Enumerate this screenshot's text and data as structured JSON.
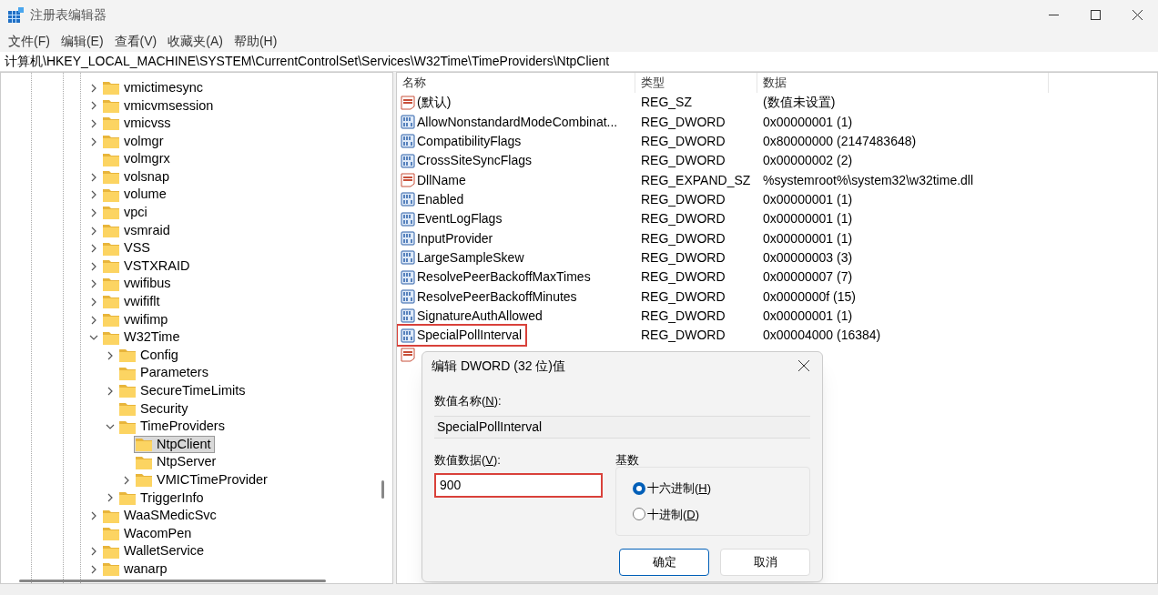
{
  "window": {
    "title": "注册表编辑器"
  },
  "menu": [
    "文件(F)",
    "编辑(E)",
    "查看(V)",
    "收藏夹(A)",
    "帮助(H)"
  ],
  "address": "计算机\\HKEY_LOCAL_MACHINE\\SYSTEM\\CurrentControlSet\\Services\\W32Time\\TimeProviders\\NtpClient",
  "tree": [
    {
      "label": "vmictimesync",
      "expandable": true,
      "expanded": false,
      "selected": false
    },
    {
      "label": "vmicvmsession",
      "expandable": true,
      "expanded": false,
      "selected": false
    },
    {
      "label": "vmicvss",
      "expandable": true,
      "expanded": false,
      "selected": false
    },
    {
      "label": "volmgr",
      "expandable": true,
      "expanded": false,
      "selected": false
    },
    {
      "label": "volmgrx",
      "expandable": false,
      "selected": false
    },
    {
      "label": "volsnap",
      "expandable": true,
      "expanded": false,
      "selected": false
    },
    {
      "label": "volume",
      "expandable": true,
      "expanded": false,
      "selected": false
    },
    {
      "label": "vpci",
      "expandable": true,
      "expanded": false,
      "selected": false
    },
    {
      "label": "vsmraid",
      "expandable": true,
      "expanded": false,
      "selected": false
    },
    {
      "label": "VSS",
      "expandable": true,
      "expanded": false,
      "selected": false
    },
    {
      "label": "VSTXRAID",
      "expandable": true,
      "expanded": false,
      "selected": false
    },
    {
      "label": "vwifibus",
      "expandable": true,
      "expanded": false,
      "selected": false
    },
    {
      "label": "vwififlt",
      "expandable": true,
      "expanded": false,
      "selected": false
    },
    {
      "label": "vwifimp",
      "expandable": true,
      "expanded": false,
      "selected": false
    },
    {
      "label": "W32Time",
      "expandable": true,
      "expanded": true,
      "selected": false,
      "children": [
        {
          "label": "Config",
          "expandable": true,
          "expanded": false,
          "selected": false
        },
        {
          "label": "Parameters",
          "expandable": false,
          "selected": false
        },
        {
          "label": "SecureTimeLimits",
          "expandable": true,
          "expanded": false,
          "selected": false
        },
        {
          "label": "Security",
          "expandable": false,
          "selected": false
        },
        {
          "label": "TimeProviders",
          "expandable": true,
          "expanded": true,
          "selected": false,
          "children": [
            {
              "label": "NtpClient",
              "expandable": false,
              "selected": true
            },
            {
              "label": "NtpServer",
              "expandable": false,
              "selected": false
            },
            {
              "label": "VMICTimeProvider",
              "expandable": true,
              "expanded": false,
              "selected": false
            }
          ]
        },
        {
          "label": "TriggerInfo",
          "expandable": true,
          "expanded": false,
          "selected": false
        }
      ]
    },
    {
      "label": "WaaSMedicSvc",
      "expandable": true,
      "expanded": false,
      "selected": false
    },
    {
      "label": "WacomPen",
      "expandable": false,
      "selected": false
    },
    {
      "label": "WalletService",
      "expandable": true,
      "expanded": false,
      "selected": false
    },
    {
      "label": "wanarp",
      "expandable": true,
      "expanded": false,
      "selected": false
    }
  ],
  "table": {
    "columns": [
      "名称",
      "类型",
      "数据"
    ],
    "rows": [
      {
        "kind": "string",
        "name": "(默认)",
        "type": "REG_SZ",
        "data": "(数值未设置)",
        "annotated": false
      },
      {
        "kind": "binary",
        "name": "AllowNonstandardModeCombinat...",
        "type": "REG_DWORD",
        "data": "0x00000001 (1)",
        "annotated": false
      },
      {
        "kind": "binary",
        "name": "CompatibilityFlags",
        "type": "REG_DWORD",
        "data": "0x80000000 (2147483648)",
        "annotated": false
      },
      {
        "kind": "binary",
        "name": "CrossSiteSyncFlags",
        "type": "REG_DWORD",
        "data": "0x00000002 (2)",
        "annotated": false
      },
      {
        "kind": "string",
        "name": "DllName",
        "type": "REG_EXPAND_SZ",
        "data": "%systemroot%\\system32\\w32time.dll",
        "annotated": false
      },
      {
        "kind": "binary",
        "name": "Enabled",
        "type": "REG_DWORD",
        "data": "0x00000001 (1)",
        "annotated": false
      },
      {
        "kind": "binary",
        "name": "EventLogFlags",
        "type": "REG_DWORD",
        "data": "0x00000001 (1)",
        "annotated": false
      },
      {
        "kind": "binary",
        "name": "InputProvider",
        "type": "REG_DWORD",
        "data": "0x00000001 (1)",
        "annotated": false
      },
      {
        "kind": "binary",
        "name": "LargeSampleSkew",
        "type": "REG_DWORD",
        "data": "0x00000003 (3)",
        "annotated": false
      },
      {
        "kind": "binary",
        "name": "ResolvePeerBackoffMaxTimes",
        "type": "REG_DWORD",
        "data": "0x00000007 (7)",
        "annotated": false
      },
      {
        "kind": "binary",
        "name": "ResolvePeerBackoffMinutes",
        "type": "REG_DWORD",
        "data": "0x0000000f (15)",
        "annotated": false
      },
      {
        "kind": "binary",
        "name": "SignatureAuthAllowed",
        "type": "REG_DWORD",
        "data": "0x00000001 (1)",
        "annotated": false
      },
      {
        "kind": "binary",
        "name": "SpecialPollInterval",
        "type": "REG_DWORD",
        "data": "0x00004000 (16384)",
        "annotated": true
      },
      {
        "kind": "string"
      }
    ]
  },
  "dialog": {
    "title": "编辑 DWORD (32 位)值",
    "name_label": {
      "prefix": "数值名称(",
      "key": "N",
      "suffix": "):"
    },
    "name_value": "SpecialPollInterval",
    "data_label": {
      "prefix": "数值数据(",
      "key": "V",
      "suffix": "):"
    },
    "data_value": "900",
    "data_annotated": true,
    "base_title": "基数",
    "bases": [
      {
        "prefix": "十六进制(",
        "key": "H",
        "suffix": ")",
        "selected": true
      },
      {
        "prefix": "十进制(",
        "key": "D",
        "suffix": ")",
        "selected": false
      }
    ],
    "buttons": [
      {
        "label": "确定",
        "default": true
      },
      {
        "label": "取消",
        "default": false
      }
    ]
  }
}
